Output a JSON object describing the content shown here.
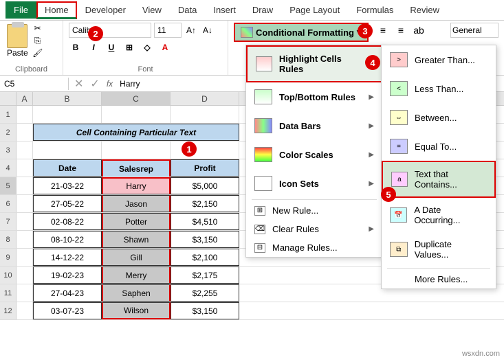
{
  "tabs": {
    "file": "File",
    "home": "Home",
    "developer": "Developer",
    "view": "View",
    "data": "Data",
    "insert": "Insert",
    "draw": "Draw",
    "page_layout": "Page Layout",
    "formulas": "Formulas",
    "review": "Review"
  },
  "ribbon": {
    "clipboard_label": "Clipboard",
    "paste_label": "Paste",
    "font_label": "Font",
    "font_name": "Calibri",
    "font_size": "11",
    "cond_fmt": "Conditional Formatting",
    "number_format": "General"
  },
  "namebox": "C5",
  "formula_value": "Harry",
  "sheet": {
    "title": "Cell Containing Particular Text",
    "headers": {
      "date": "Date",
      "salesrep": "Salesrep",
      "profit": "Profit"
    },
    "rows": [
      {
        "date": "21-03-22",
        "rep": "Harry",
        "profit": "$5,000"
      },
      {
        "date": "27-05-22",
        "rep": "Jason",
        "profit": "$2,150"
      },
      {
        "date": "02-08-22",
        "rep": "Potter",
        "profit": "$4,510"
      },
      {
        "date": "08-10-22",
        "rep": "Shawn",
        "profit": "$3,150"
      },
      {
        "date": "14-12-22",
        "rep": "Gill",
        "profit": "$2,100"
      },
      {
        "date": "19-02-23",
        "rep": "Merry",
        "profit": "$2,175"
      },
      {
        "date": "27-04-23",
        "rep": "Saphen",
        "profit": "$2,255"
      },
      {
        "date": "03-07-23",
        "rep": "Wilson",
        "profit": "$3,150"
      }
    ],
    "cols": [
      "A",
      "B",
      "C",
      "D"
    ]
  },
  "menu": {
    "highlight": "Highlight Cells Rules",
    "topbottom": "Top/Bottom Rules",
    "databars": "Data Bars",
    "colorscales": "Color Scales",
    "iconsets": "Icon Sets",
    "newrule": "New Rule...",
    "clearrules": "Clear Rules",
    "managerules": "Manage Rules..."
  },
  "submenu": {
    "greater": "Greater Than...",
    "less": "Less Than...",
    "between": "Between...",
    "equal": "Equal To...",
    "textcontains": "Text that Contains...",
    "dateoccurring": "A Date Occurring...",
    "duplicate": "Duplicate Values...",
    "morerules": "More Rules..."
  },
  "badges": {
    "b1": "1",
    "b2": "2",
    "b3": "3",
    "b4": "4",
    "b5": "5"
  },
  "watermark": "wsxdn.com"
}
